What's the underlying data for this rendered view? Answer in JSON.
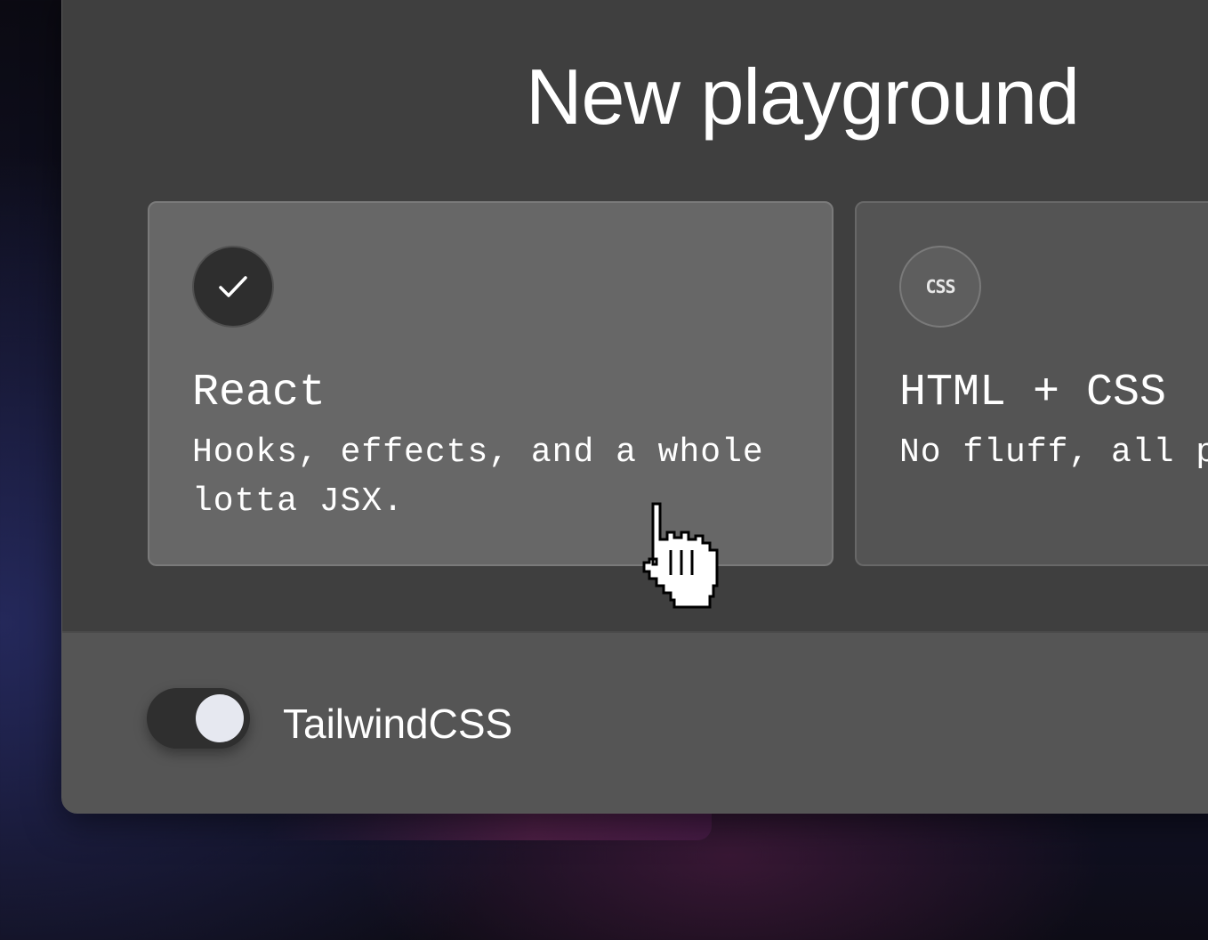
{
  "dialog": {
    "title": "New playground"
  },
  "templates": [
    {
      "title": "React",
      "description": "Hooks, effects, and a whole lotta JSX.",
      "icon": "check-icon",
      "selected": true
    },
    {
      "title": "HTML + CSS",
      "description": "No fluff, all possibilities.",
      "icon": "css-icon",
      "icon_text": "CSS",
      "selected": false
    }
  ],
  "options": {
    "tailwind_label": "TailwindCSS",
    "tailwind_enabled": true
  },
  "cursor": "pointer-hand-icon",
  "colors": {
    "dialog_bg": "#3f3f3f",
    "card_selected_bg": "#676767",
    "card_bg": "#545454",
    "footer_bg": "#555555",
    "toggle_track": "#2f2f2f",
    "toggle_knob": "#e6e8f0"
  }
}
